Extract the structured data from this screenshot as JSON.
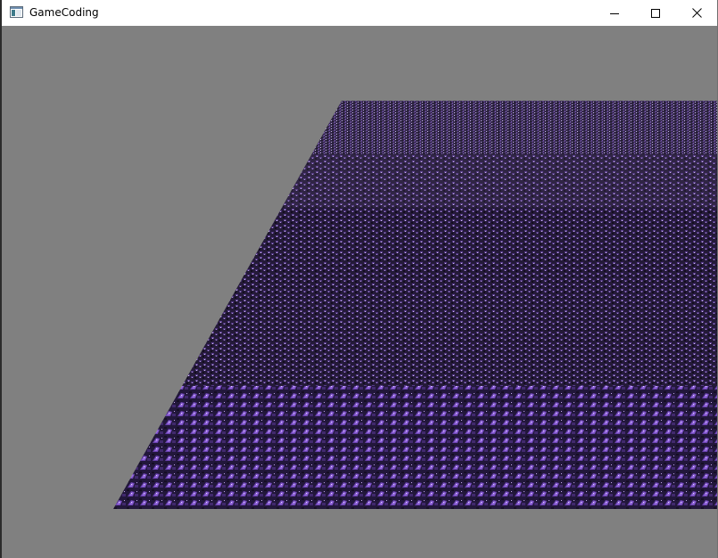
{
  "window": {
    "title": "GameCoding",
    "background_color": "#808080"
  },
  "titlebar": {
    "app_icon": "application-window-icon",
    "buttons": [
      {
        "name": "minimize",
        "icon": "minimize-icon"
      },
      {
        "name": "maximize",
        "icon": "maximize-icon"
      },
      {
        "name": "close",
        "icon": "close-icon"
      }
    ]
  },
  "scene": {
    "object": "textured-ground-plane",
    "texture_colors": [
      "#1a1228",
      "#3b2a5c",
      "#6a46a8",
      "#9b6fe0",
      "#d8c8f0"
    ]
  }
}
